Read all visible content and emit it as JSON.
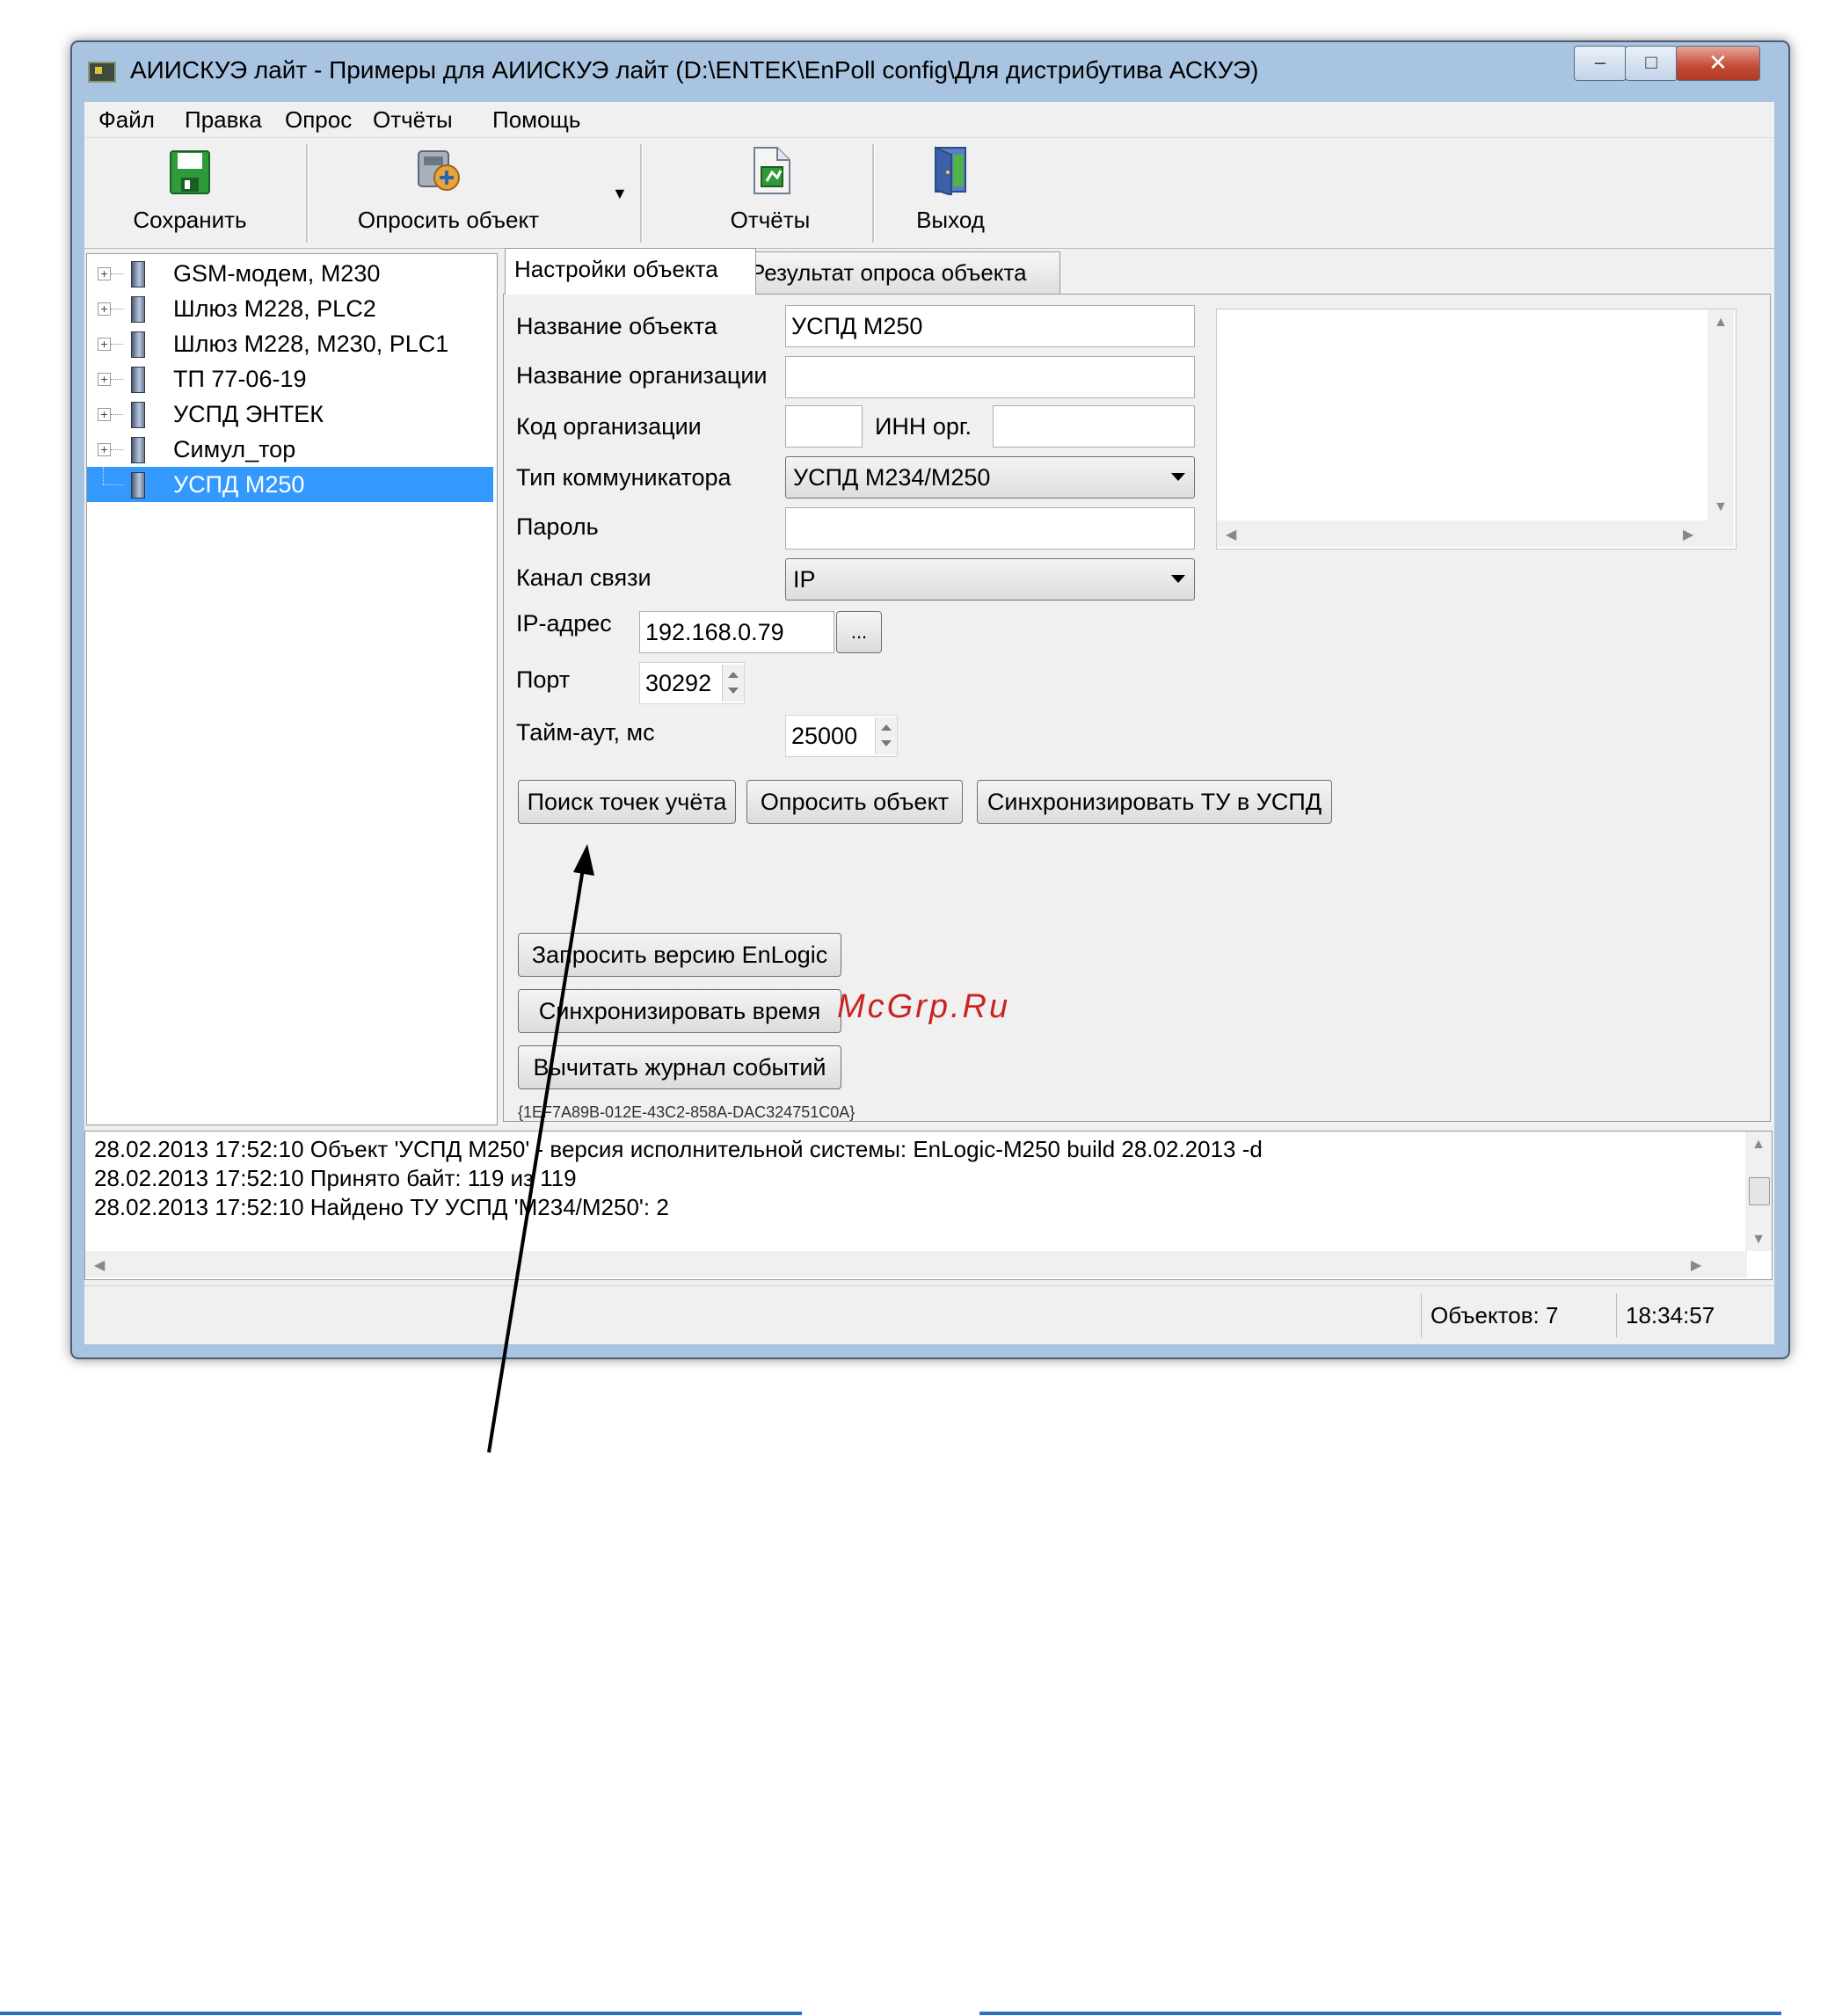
{
  "window": {
    "title": "АИИСКУЭ лайт - Примеры для АИИСКУЭ лайт (D:\\ENTEK\\EnPoll config\\Для дистрибутива АСКУЭ)",
    "controls": {
      "minimize": "–",
      "maximize": "□",
      "close": "✕"
    }
  },
  "menu": [
    "Файл",
    "Правка",
    "Опрос",
    "Отчёты",
    "Помощь"
  ],
  "toolbar": {
    "save": "Сохранить",
    "poll": "Опросить объект",
    "reports": "Отчёты",
    "exit": "Выход",
    "dropdown_glyph": "▼"
  },
  "tree": {
    "items": [
      {
        "label": "GSM-модем, M230",
        "expandable": true
      },
      {
        "label": "Шлюз M228, PLC2",
        "expandable": true
      },
      {
        "label": "Шлюз M228, M230, PLC1",
        "expandable": true
      },
      {
        "label": "ТП 77-06-19",
        "expandable": true
      },
      {
        "label": "УСПД ЭНТЕК",
        "expandable": true
      },
      {
        "label": "Симул_тор",
        "expandable": true
      },
      {
        "label": "УСПД M250",
        "expandable": false,
        "selected": true
      }
    ]
  },
  "tabs": [
    "Настройки объекта",
    "Результат опроса объекта"
  ],
  "form": {
    "object_name_label": "Название объекта",
    "object_name_value": "УСПД М250",
    "org_name_label": "Название организации",
    "org_name_value": "",
    "org_code_label": "Код организации",
    "org_code_value": "",
    "inn_label": "ИНН орг.",
    "inn_value": "",
    "comm_type_label": "Тип коммуникатора",
    "comm_type_value": "УСПД М234/М250",
    "password_label": "Пароль",
    "password_value": "",
    "channel_label": "Канал связи",
    "channel_value": "IP",
    "ip_label": "IP-адрес",
    "ip_value": "192.168.0.79",
    "ip_browse": "...",
    "port_label": "Порт",
    "port_value": "30292",
    "timeout_label": "Тайм-аут, мс",
    "timeout_value": "25000"
  },
  "buttons": {
    "find_points": "Поиск точек учёта",
    "poll_object": "Опросить объект",
    "sync_tu": "Синхронизировать ТУ в УСПД",
    "request_version": "Запросить версию EnLogic",
    "sync_time": "Синхронизировать время",
    "read_log": "Вычитать журнал событий"
  },
  "guid": "{1EF7A89B-012E-43C2-858A-DAC324751C0A}",
  "log": [
    "28.02.2013 17:52:10  Объект 'УСПД M250' - версия исполнительной системы: EnLogic-M250 build 28.02.2013 -d",
    "28.02.2013 17:52:10  Принято байт: 119 из 119",
    "28.02.2013 17:52:10  Найдено ТУ УСПД 'M234/M250': 2"
  ],
  "status": {
    "objects": "Объектов: 7",
    "time": "18:34:57"
  },
  "watermark": "McGrp.Ru",
  "colors": {
    "selection": "#3399ff",
    "titlebar": "#a9c4e1",
    "close_button": "#c44a35",
    "watermark": "#cc2222"
  }
}
